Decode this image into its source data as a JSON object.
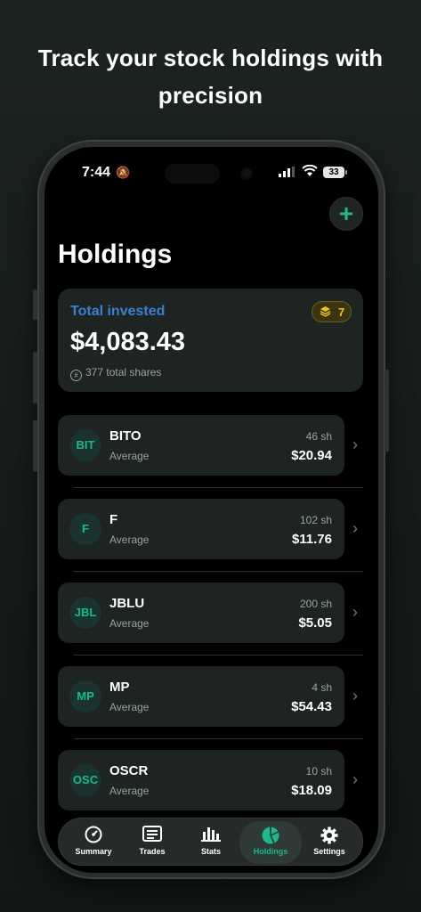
{
  "headline": {
    "line1": "Track your stock holdings with",
    "line2": "precision"
  },
  "status_bar": {
    "time": "7:44",
    "battery": "33"
  },
  "header": {
    "add_label": "+",
    "title": "Holdings"
  },
  "summary": {
    "label": "Total invested",
    "count": "7",
    "amount": "$4,083.43",
    "shares_text": "377 total shares"
  },
  "holdings": [
    {
      "avatar": "BIT",
      "ticker": "BITO",
      "avg_label": "Average",
      "shares": "46 sh",
      "price": "$20.94"
    },
    {
      "avatar": "F",
      "ticker": "F",
      "avg_label": "Average",
      "shares": "102 sh",
      "price": "$11.76"
    },
    {
      "avatar": "JBL",
      "ticker": "JBLU",
      "avg_label": "Average",
      "shares": "200 sh",
      "price": "$5.05"
    },
    {
      "avatar": "MP",
      "ticker": "MP",
      "avg_label": "Average",
      "shares": "4 sh",
      "price": "$54.43"
    },
    {
      "avatar": "OSC",
      "ticker": "OSCR",
      "avg_label": "Average",
      "shares": "10 sh",
      "price": "$18.09"
    }
  ],
  "tabs": [
    {
      "label": "Summary",
      "icon": "gauge-icon"
    },
    {
      "label": "Trades",
      "icon": "list-icon"
    },
    {
      "label": "Stats",
      "icon": "bar-chart-icon"
    },
    {
      "label": "Holdings",
      "icon": "pie-chart-icon",
      "active": true
    },
    {
      "label": "Settings",
      "icon": "gear-icon"
    }
  ],
  "colors": {
    "accent": "#1fb88c",
    "summary_label": "#3b7fd1",
    "badge": "#f0c419",
    "card": "#1d2422"
  }
}
